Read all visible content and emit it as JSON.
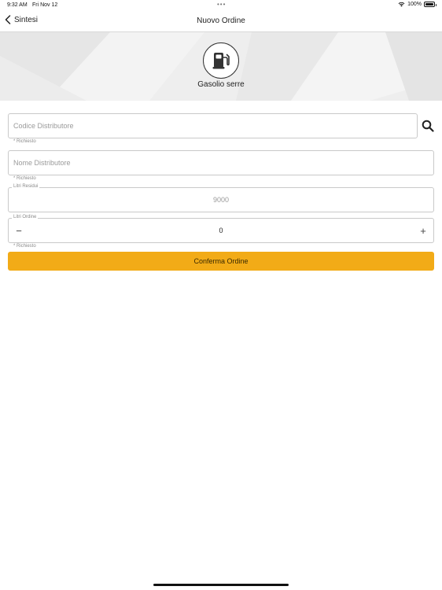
{
  "status_bar": {
    "time": "9:32 AM",
    "date": "Fri Nov 12",
    "dots": "•••",
    "battery_text": "100%",
    "icons": [
      "wifi-icon",
      "battery-icon"
    ]
  },
  "nav": {
    "back_label": "Sintesi",
    "title": "Nuovo Ordine",
    "back_icon": "chevron-left-icon"
  },
  "product": {
    "name": "Gasolio serre",
    "icon": "fuel-pump-icon"
  },
  "form": {
    "codice": {
      "placeholder": "Codice Distributore",
      "value": "",
      "hint": "* Richiesto"
    },
    "search_icon": "search-icon",
    "nome": {
      "placeholder": "Nome Distributore",
      "value": "",
      "hint": "* Richiesto"
    },
    "litri_residui": {
      "label": "Litri Residui",
      "value": "9000"
    },
    "litri_ordine": {
      "label": "Litri Ordine",
      "value": "0",
      "minus": "−",
      "plus": "+",
      "hint": "* Richiesto"
    },
    "confirm_label": "Conferma Ordine"
  },
  "colors": {
    "accent": "#f2ab17",
    "banner_bg": "#eeeeee",
    "border": "#c9c9c9"
  }
}
